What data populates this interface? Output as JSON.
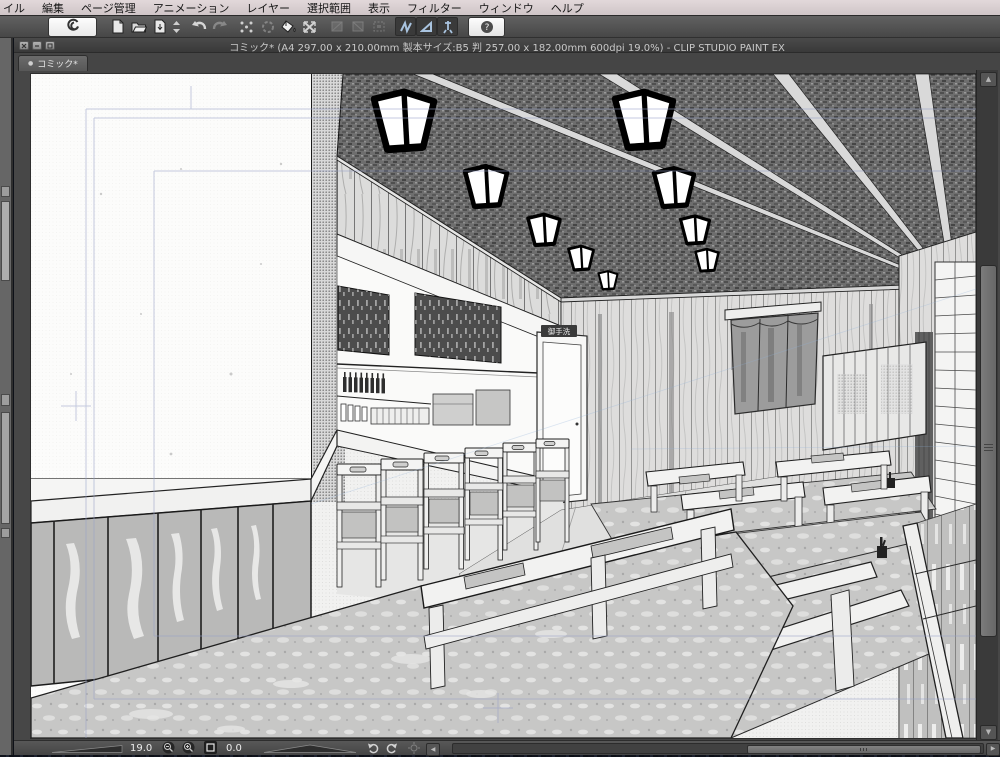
{
  "app": {
    "name": "CLIP STUDIO PAINT EX"
  },
  "menu_bar": {
    "items": [
      "イル",
      "編集",
      "ページ管理",
      "アニメーション",
      "レイヤー",
      "選択範囲",
      "表示",
      "フィルター",
      "ウィンドウ",
      "ヘルプ"
    ]
  },
  "toolbar": {
    "help_glyph": "?",
    "icons": [
      "clip-studio-logo",
      "new-document",
      "open-file",
      "save-page",
      "stepper-arrows",
      "undo",
      "redo",
      "deselect",
      "select-dimmed",
      "fill-bucket",
      "transform",
      "layer-dimmed-1",
      "layer-dimmed-2",
      "layer-dimmed-3",
      "snap-ruler",
      "snap-special-ruler",
      "snap-grid",
      "help"
    ]
  },
  "document_window": {
    "title": "コミック* (A4 297.00 x 210.00mm 製本サイズ:B5 判 257.00 x 182.00mm 600dpi 19.0%) - CLIP STUDIO PAINT EX",
    "tab": {
      "modified_indicator": "●",
      "label": "コミック*"
    }
  },
  "canvas": {
    "door_sign_text": "御手洗"
  },
  "status_bar": {
    "zoom_value": "19.0",
    "rotation_value": "0.0"
  },
  "colors": {
    "menu_bar_bg": "#d6ccce",
    "toolbar_bg": "#525252",
    "titlebar_bg": "#3f3f3f",
    "canvas_bg": "#474747",
    "page_white": "#fbfbfa",
    "snap_icon": "#a9c4e0",
    "guide_line": "#96a0c8",
    "status_bar_bg": "#4c4c4c",
    "ceiling_tone": "#6e6e6e"
  }
}
